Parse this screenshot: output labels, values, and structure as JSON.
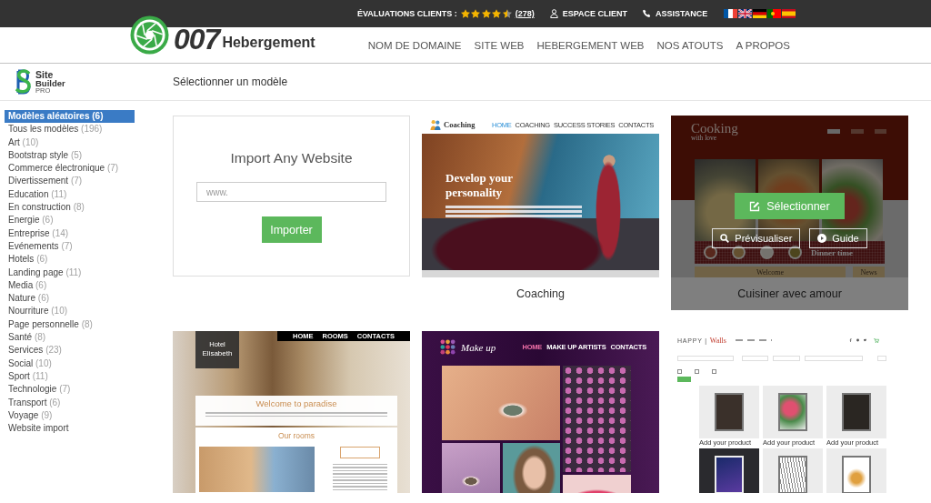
{
  "top_bar": {
    "rating_label": "ÉVALUATIONS CLIENTS :",
    "stars": 4.5,
    "rating_count": "(278)",
    "links": [
      {
        "kind": "account",
        "label": "ESPACE CLIENT"
      },
      {
        "kind": "phone",
        "label": "ASSISTANCE"
      }
    ],
    "languages": [
      {
        "kind": "france"
      },
      {
        "kind": "britain"
      },
      {
        "kind": "germany"
      },
      {
        "kind": "portugal"
      },
      {
        "kind": "spain"
      }
    ]
  },
  "header": {
    "logo_number": "007",
    "logo_word": "Hebergement",
    "nav": [
      "NOM DE DOMAINE",
      "SITE WEB",
      "HEBERGEMENT WEB",
      "NOS ATOUTS",
      "A PROPOS"
    ]
  },
  "builder_header": {
    "logo_lines": [
      "Site",
      "Builder",
      "PRO"
    ],
    "title": "Sélectionner un modèle"
  },
  "sidebar": {
    "items": [
      {
        "name": "Modèles aléatoires",
        "count": "(6)",
        "selected": true
      },
      {
        "name": "Tous les modèles",
        "count": "(196)",
        "selected": false
      },
      {
        "name": "Art",
        "count": "(10)",
        "selected": false
      },
      {
        "name": "Bootstrap style",
        "count": "(5)",
        "selected": false
      },
      {
        "name": "Commerce électronique",
        "count": "(7)",
        "selected": false
      },
      {
        "name": "Divertissement",
        "count": "(7)",
        "selected": false
      },
      {
        "name": "Education",
        "count": "(11)",
        "selected": false
      },
      {
        "name": "En construction",
        "count": "(8)",
        "selected": false
      },
      {
        "name": "Energie",
        "count": "(6)",
        "selected": false
      },
      {
        "name": "Entreprise",
        "count": "(14)",
        "selected": false
      },
      {
        "name": "Evénements",
        "count": "(7)",
        "selected": false
      },
      {
        "name": "Hotels",
        "count": "(6)",
        "selected": false
      },
      {
        "name": "Landing page",
        "count": "(11)",
        "selected": false
      },
      {
        "name": "Media",
        "count": "(6)",
        "selected": false
      },
      {
        "name": "Nature",
        "count": "(6)",
        "selected": false
      },
      {
        "name": "Nourriture",
        "count": "(10)",
        "selected": false
      },
      {
        "name": "Page personnelle",
        "count": "(8)",
        "selected": false
      },
      {
        "name": "Santé",
        "count": "(8)",
        "selected": false
      },
      {
        "name": "Services",
        "count": "(23)",
        "selected": false
      },
      {
        "name": "Social",
        "count": "(10)",
        "selected": false
      },
      {
        "name": "Sport",
        "count": "(11)",
        "selected": false
      },
      {
        "name": "Technologie",
        "count": "(7)",
        "selected": false
      },
      {
        "name": "Transport",
        "count": "(6)",
        "selected": false
      },
      {
        "name": "Voyage",
        "count": "(9)",
        "selected": false
      },
      {
        "name": "Website import",
        "selected": false
      }
    ]
  },
  "templates": [
    {
      "kind": "import",
      "hovered": false,
      "title": "Import Any Website",
      "placeholder": "www.",
      "button": "Importer"
    },
    {
      "kind": "coaching",
      "hovered": false,
      "label": "Coaching",
      "preview": {
        "brand": "Coaching",
        "nav": [
          {
            "label": "HOME",
            "selected": true
          },
          {
            "label": "COACHING",
            "selected": false
          },
          {
            "label": "SUCCESS STORIES",
            "selected": false
          },
          {
            "label": "CONTACTS",
            "selected": false
          }
        ],
        "headline": "Develop your personality"
      }
    },
    {
      "kind": "cooking",
      "hovered": true,
      "label": "Cuisiner avec amour",
      "actions": [
        {
          "kind": "select",
          "label": "Sélectionner"
        },
        {
          "kind": "preview",
          "label": "Prévisualiser"
        },
        {
          "kind": "guide",
          "label": "Guide"
        }
      ],
      "preview": {
        "brand": "Cooking",
        "tagline": "with love",
        "band_text": "Dinner time",
        "boxes": [
          "Welcome",
          "News"
        ]
      }
    },
    {
      "kind": "hotel",
      "hovered": false,
      "preview": {
        "brand_small": "Hotel",
        "brand": "Elisabeth",
        "nav": [
          "HOME",
          "ROOMS",
          "CONTACTS"
        ],
        "welcome": "Welcome to paradise",
        "section": "Our rooms"
      }
    },
    {
      "kind": "makeup",
      "hovered": false,
      "preview": {
        "brand": "Make up",
        "nav": [
          {
            "label": "HOME",
            "selected": true
          },
          {
            "label": "MAKE UP ARTISTS",
            "selected": false
          },
          {
            "label": "CONTACTS",
            "selected": false
          }
        ]
      }
    },
    {
      "kind": "shop",
      "hovered": false,
      "preview": {
        "brand": "HAPPY |",
        "brand_accent": "Walls",
        "products": [
          "Add your product",
          "Add your product",
          "Add your product"
        ]
      }
    }
  ]
}
